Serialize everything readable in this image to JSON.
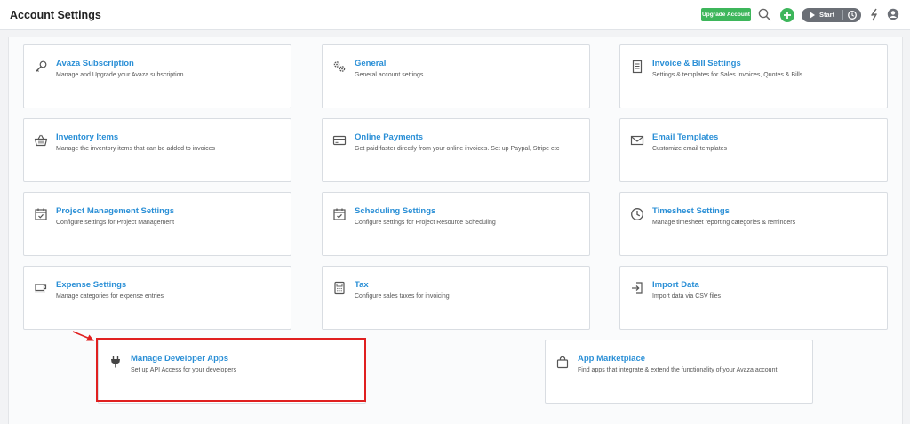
{
  "header": {
    "title": "Account Settings",
    "upgrade_label": "Upgrade Account",
    "timer_label": "Start"
  },
  "colors": {
    "accent": "#2a8fd6",
    "upgrade_green": "#3db65b",
    "highlight_red": "#e02020",
    "timer_gray": "#6b6f76"
  },
  "settings": [
    {
      "title": "Avaza Subscription",
      "desc": "Manage and Upgrade your Avaza subscription",
      "icon": "key-icon"
    },
    {
      "title": "General",
      "desc": "General account settings",
      "icon": "gears-icon"
    },
    {
      "title": "Invoice & Bill Settings",
      "desc": "Settings & templates for Sales Invoices, Quotes & Bills",
      "icon": "invoice-icon"
    },
    {
      "title": "Inventory Items",
      "desc": "Manage the inventory items that can be added to invoices",
      "icon": "basket-icon"
    },
    {
      "title": "Online Payments",
      "desc": "Get paid faster directly from your online invoices. Set up Paypal, Stripe etc",
      "icon": "credit-card-icon"
    },
    {
      "title": "Email Templates",
      "desc": "Customize email templates",
      "icon": "envelope-icon"
    },
    {
      "title": "Project Management Settings",
      "desc": "Configure settings for Project Management",
      "icon": "calendar-check-icon"
    },
    {
      "title": "Scheduling Settings",
      "desc": "Configure settings for Project Resource Scheduling",
      "icon": "calendar-check-icon"
    },
    {
      "title": "Timesheet Settings",
      "desc": "Manage timesheet reporting categories & reminders",
      "icon": "clock-icon"
    },
    {
      "title": "Expense Settings",
      "desc": "Manage categories for expense entries",
      "icon": "coffee-cup-icon"
    },
    {
      "title": "Tax",
      "desc": "Configure sales taxes for invoicing",
      "icon": "calculator-icon"
    },
    {
      "title": "Import Data",
      "desc": "Import data via CSV files",
      "icon": "import-icon"
    },
    {
      "title": "Manage Developer Apps",
      "desc": "Set up API Access for your developers",
      "icon": "plug-icon"
    },
    {
      "title": "App Marketplace",
      "desc": "Find apps that integrate & extend the functionality of your Avaza account",
      "icon": "shopping-bag-icon"
    }
  ]
}
